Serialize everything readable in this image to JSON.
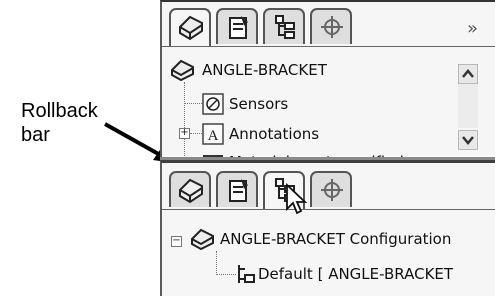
{
  "annotation": {
    "line1": "Rollback",
    "line2": "bar"
  },
  "top_panel": {
    "root_label": "ANGLE-BRACKET",
    "items": [
      {
        "label": "Sensors"
      },
      {
        "label": "Annotations"
      },
      {
        "label": "Material <not specified>"
      }
    ],
    "more_glyph": "»",
    "expand_glyph": "+"
  },
  "bottom_panel": {
    "root_label": "ANGLE-BRACKET Configuration",
    "default_label": "Default [ ANGLE-BRACKET",
    "collapse_glyph": "−"
  },
  "tabs": [
    {
      "icon": "feature-manager-icon"
    },
    {
      "icon": "property-manager-icon"
    },
    {
      "icon": "configuration-manager-icon"
    },
    {
      "icon": "dimxpert-manager-icon"
    }
  ]
}
